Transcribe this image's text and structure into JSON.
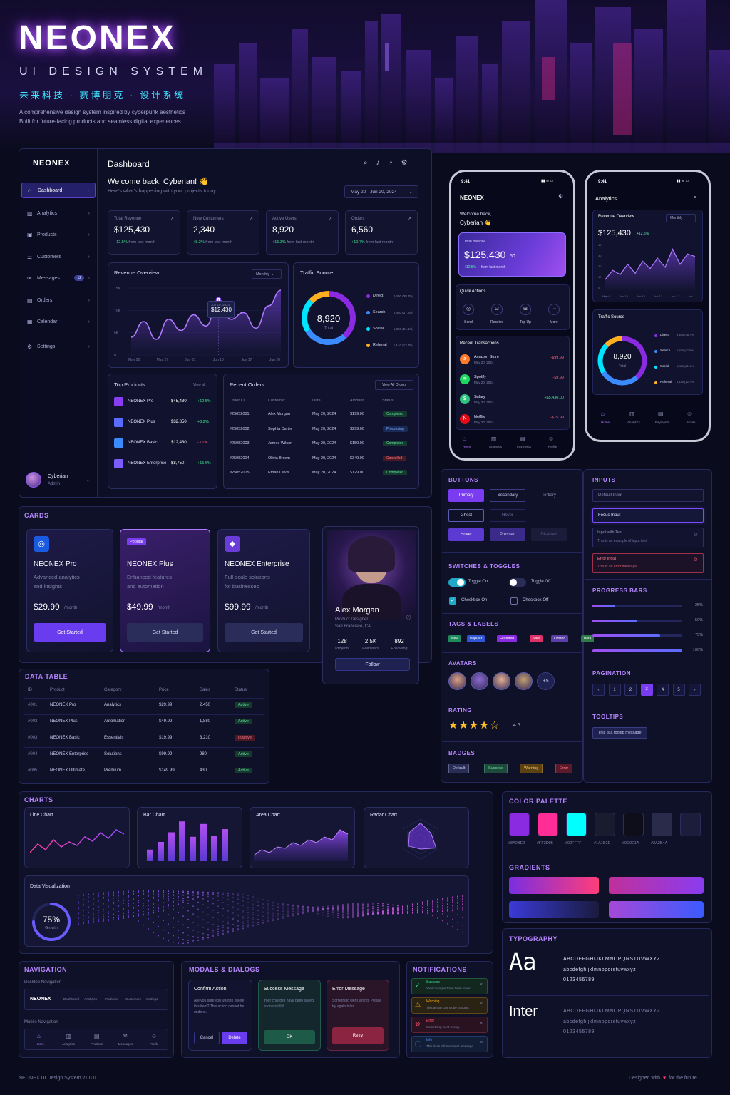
{
  "brand": {
    "name": "NEONEX",
    "subtitle": "UI DESIGN SYSTEM",
    "cn": "未来科技 · 赛博朋克 · 设计系统",
    "desc1": "A comprehensive design system inspired by cyberpunk aesthetics",
    "desc2": "Built for future-facing products and seamless digital experiences."
  },
  "colors": {
    "purple": "#8A2BE2",
    "pink": "#FF2D95",
    "cyan": "#00FFFF",
    "navy": "#1A1B2E",
    "dark": "#0D0E1A",
    "slate": "#2A2B4A"
  },
  "sidebar": {
    "logo": "NEONEX",
    "items": [
      {
        "label": "Dashboard",
        "icon": "home-icon"
      },
      {
        "label": "Analytics",
        "icon": "bar-chart-icon"
      },
      {
        "label": "Products",
        "icon": "box-icon"
      },
      {
        "label": "Customers",
        "icon": "users-icon"
      },
      {
        "label": "Messages",
        "icon": "message-icon",
        "badge": "12"
      },
      {
        "label": "Orders",
        "icon": "orders-icon"
      },
      {
        "label": "Calendar",
        "icon": "calendar-icon"
      },
      {
        "label": "Settings",
        "icon": "gear-icon"
      }
    ],
    "user": {
      "name": "Cyberian",
      "role": "Admin"
    }
  },
  "dashboard": {
    "title": "Dashboard",
    "welcome": "Welcome back, Cyberian! 👋",
    "sub": "Here's what's happening with your projects today.",
    "date": "May 20 - Jun 20, 2024",
    "kpis": [
      {
        "label": "Total Revenue",
        "value": "$125,430",
        "delta": "+12.5%",
        "note": "from last month"
      },
      {
        "label": "New Customers",
        "value": "2,340",
        "delta": "+8.2%",
        "note": "from last month"
      },
      {
        "label": "Active Users",
        "value": "8,920",
        "delta": "+15.3%",
        "note": "from last month"
      },
      {
        "label": "Orders",
        "value": "6,560",
        "delta": "+10.7%",
        "note": "from last month"
      }
    ],
    "revenue": {
      "title": "Revenue Overview",
      "period": "Monthly",
      "tooltip_date": "Jun 10, 2024",
      "tooltip_value": "$12,430",
      "yticks": [
        "15K",
        "10K",
        "5K",
        "0"
      ],
      "xticks": [
        "May 20",
        "May 27",
        "Jun 03",
        "Jun 10",
        "Jun 17",
        "Jun 20"
      ]
    },
    "traffic": {
      "title": "Traffic Source",
      "total": "8,920",
      "total_label": "Total",
      "items": [
        {
          "name": "Direct",
          "value": "3,450 (38.7%)",
          "color": "#8A2BE2"
        },
        {
          "name": "Search",
          "value": "2,450 (27.5%)",
          "color": "#3b8bff"
        },
        {
          "name": "Social",
          "value": "1,880 (21.1%)",
          "color": "#00e5ff"
        },
        {
          "name": "Referral",
          "value": "1,140 (12.7%)",
          "color": "#ffb020"
        }
      ]
    },
    "top_products": {
      "title": "Top Products",
      "link": "View all",
      "items": [
        {
          "name": "NEONEX Pro",
          "value": "$45,430",
          "delta": "+12.5%"
        },
        {
          "name": "NEONEX Plus",
          "value": "$32,850",
          "delta": "+8.2%"
        },
        {
          "name": "NEONEX Basic",
          "value": "$12,430",
          "delta": "-3.1%"
        },
        {
          "name": "NEONEX Enterprise",
          "value": "$8,750",
          "delta": "+15.6%"
        }
      ]
    },
    "orders": {
      "title": "Recent Orders",
      "link": "View All Orders",
      "headers": [
        "Order ID",
        "Customer",
        "Date",
        "Amount",
        "Status"
      ],
      "rows": [
        [
          "#25052001",
          "Alex Morgan",
          "May 20, 2024",
          "$199.00",
          "Completed"
        ],
        [
          "#25052002",
          "Sophia Carter",
          "May 20, 2024",
          "$299.00",
          "Processing"
        ],
        [
          "#25052003",
          "James Wilson",
          "May 20, 2024",
          "$159.00",
          "Completed"
        ],
        [
          "#25052004",
          "Olivia Brown",
          "May 20, 2024",
          "$349.00",
          "Cancelled"
        ],
        [
          "#25052005",
          "Ethan Davis",
          "May 20, 2024",
          "$129.00",
          "Completed"
        ]
      ]
    }
  },
  "phone1": {
    "time": "9:41",
    "logo": "NEONEX",
    "welcome": "Welcome back,",
    "name": "Cyberian 👋",
    "balance_label": "Total Balance",
    "balance": "$125,430",
    "cents": ".50",
    "delta": "+12.5%",
    "delta_note": "from last month",
    "qa_title": "Quick Actions",
    "actions": [
      "Send",
      "Receive",
      "Top Up",
      "More"
    ],
    "tx_title": "Recent Transactions",
    "tx": [
      {
        "name": "Amazon Store",
        "date": "May 20, 2024",
        "amt": "-$99.99"
      },
      {
        "name": "Spotify",
        "date": "May 20, 2024",
        "amt": "-$9.99"
      },
      {
        "name": "Salary",
        "date": "May 20, 2024",
        "amt": "+$5,430.00"
      },
      {
        "name": "Netflix",
        "date": "May 20, 2024",
        "amt": "-$15.99"
      }
    ],
    "nav": [
      "Home",
      "Analytics",
      "Payments",
      "Profile"
    ]
  },
  "phone2": {
    "time": "9:41",
    "title": "Analytics",
    "rev_title": "Revenue Overview",
    "period": "Monthly",
    "value": "$125,430",
    "delta": "+12.5%",
    "yticks": [
      "40",
      "30",
      "20",
      "10",
      "0"
    ],
    "xticks": [
      "May 6",
      "Jun 13",
      "Jun 13",
      "Jun 13",
      "Jun 13",
      "Jun 1"
    ],
    "traffic_title": "Traffic Source",
    "total": "8,920",
    "total_label": "Total",
    "items": [
      {
        "name": "Direct",
        "value": "3,450 (38.7%)"
      },
      {
        "name": "Search",
        "value": "2,450 (27.5%)"
      },
      {
        "name": "Social",
        "value": "1,880 (21.1%)"
      },
      {
        "name": "Referral",
        "value": "1,140 (12.7%)"
      }
    ],
    "nav": [
      "Home",
      "Analytics",
      "Payments",
      "Profile"
    ]
  },
  "buttons": {
    "title": "BUTTONS",
    "row1": [
      "Primary",
      "Secondary",
      "Tertiary"
    ],
    "row2": [
      "Ghost",
      "Hover"
    ],
    "row3": [
      "Hover",
      "Pressed",
      "Disabled"
    ]
  },
  "inputs": {
    "title": "INPUTS",
    "default": "Default Input",
    "focus": "Focus Input",
    "with_text": "Input with Text",
    "with_text_val": "This is an example of input text",
    "error": "Error Input",
    "error_msg": "This is an error message"
  },
  "switches": {
    "title": "SWITCHES & TOGGLES",
    "on": "Toggle On",
    "off": "Toggle Off",
    "cb_on": "Checkbox On",
    "cb_off": "Checkbox Off"
  },
  "progress": {
    "title": "PROGRESS BARS",
    "items": [
      {
        "label": "25%",
        "value": 0.25
      },
      {
        "label": "50%",
        "value": 0.5
      },
      {
        "label": "75%",
        "value": 0.75
      },
      {
        "label": "100%",
        "value": 1
      }
    ]
  },
  "tags": {
    "title": "TAGS & LABELS",
    "items": [
      {
        "label": "New",
        "color": "#1f8a5c"
      },
      {
        "label": "Popular",
        "color": "#3056d3"
      },
      {
        "label": "Featured",
        "color": "#8a2be2"
      },
      {
        "label": "Sale",
        "color": "#e0306a"
      },
      {
        "label": "Limited",
        "color": "#5b3fa8"
      },
      {
        "label": "Beta",
        "color": "#2d7a4a"
      }
    ]
  },
  "pagination": {
    "title": "PAGINATION",
    "pages": [
      "‹",
      "1",
      "2",
      "3",
      "4",
      "5",
      "›"
    ],
    "active": "3"
  },
  "avatars": {
    "title": "AVATARS",
    "more": "+5"
  },
  "tooltips": {
    "title": "TOOLTIPS",
    "text": "This is a tooltip message"
  },
  "rating": {
    "title": "RATING",
    "value": "4.5",
    "stars": 4.5
  },
  "badges": {
    "title": "BADGES",
    "items": [
      {
        "label": "Default",
        "bg": "#2a2d55",
        "fg": "#c8cbee"
      },
      {
        "label": "Success",
        "bg": "#1d4a3a",
        "fg": "#6ee0a8"
      },
      {
        "label": "Warning",
        "bg": "#5a4214",
        "fg": "#ffc25a"
      },
      {
        "label": "Error",
        "bg": "#5a1a2a",
        "fg": "#ff7a8f"
      }
    ]
  },
  "cards": {
    "title": "CARDS",
    "plans": [
      {
        "name": "NEONEX Pro",
        "desc1": "Advanced analytics",
        "desc2": "and insights",
        "price": "$29.99",
        "per": "/month",
        "cta": "Get Started"
      },
      {
        "tag": "Popular",
        "name": "NEONEX Plus",
        "desc1": "Enhanced features",
        "desc2": "and automation",
        "price": "$49.99",
        "per": "/month",
        "cta": "Get Started"
      },
      {
        "name": "NEONEX Enterprise",
        "desc1": "Full-scale solutions",
        "desc2": "for businesses",
        "price": "$99.99",
        "per": "/month",
        "cta": "Get Started"
      }
    ],
    "profile": {
      "name": "Alex Morgan",
      "role": "Product Designer",
      "location": "San Francisco, CA",
      "stats": [
        {
          "v": "128",
          "l": "Projects"
        },
        {
          "v": "2.5K",
          "l": "Followers"
        },
        {
          "v": "892",
          "l": "Following"
        }
      ],
      "cta": "Follow"
    }
  },
  "table": {
    "title": "DATA TABLE",
    "headers": [
      "ID",
      "Product",
      "Category",
      "Price",
      "Sales",
      "Status"
    ],
    "rows": [
      [
        "#001",
        "NEONEX Pro",
        "Analytics",
        "$29.99",
        "2,450",
        "Active"
      ],
      [
        "#002",
        "NEONEX Plus",
        "Automation",
        "$49.99",
        "1,880",
        "Active"
      ],
      [
        "#003",
        "NEONEX Basic",
        "Essentials",
        "$19.99",
        "3,210",
        "Inactive"
      ],
      [
        "#004",
        "NEONEX Enterprise",
        "Solutions",
        "$99.99",
        "980",
        "Active"
      ],
      [
        "#005",
        "NEONEX Ultimate",
        "Premium",
        "$149.99",
        "430",
        "Active"
      ]
    ]
  },
  "charts": {
    "title": "CHARTS",
    "line": "Line Chart",
    "bar": "Bar Chart",
    "area": "Area Chart",
    "radar": "Radar Chart",
    "viz": "Data Visualization",
    "gauge_value": "75%",
    "gauge_label": "Growth",
    "gauge": 0.75
  },
  "chart_data": [
    {
      "type": "line",
      "title": "Revenue Overview",
      "categories": [
        "May 20",
        "May 27",
        "Jun 03",
        "Jun 10",
        "Jun 17",
        "Jun 20"
      ],
      "ylim": [
        0,
        15000
      ],
      "values": [
        4000,
        7500,
        3500,
        8000,
        5500,
        9000,
        6500,
        12430,
        8000,
        9500,
        6000,
        11000,
        14500
      ]
    },
    {
      "type": "bar",
      "title": "Bar Chart",
      "values": [
        18,
        30,
        45,
        62,
        38,
        58,
        40,
        50
      ]
    },
    {
      "type": "pie",
      "title": "Traffic Source",
      "categories": [
        "Direct",
        "Search",
        "Social",
        "Referral"
      ],
      "values": [
        3450,
        2450,
        1880,
        1140
      ]
    }
  ],
  "palette": {
    "title": "COLOR PALETTE",
    "colors": [
      "#8A2BE2",
      "#FF2D95",
      "#00FFFF",
      "#1A1B2E",
      "#0D0E1A",
      "#2A2B4A",
      "#1c1d3a"
    ],
    "labels": [
      "#8A2BE2",
      "#FF2D95",
      "#00FFFF",
      "#1A1B2E",
      "#0D0E1A",
      "#2A2B4A"
    ]
  },
  "gradients": {
    "title": "GRADIENTS"
  },
  "typography": {
    "title": "TYPOGRAPHY",
    "sample": "Aa",
    "upper": "ABCDEFGHIJKLMNOPQRSTUVWXYZ",
    "lower": "abcdefghijklmnopqrstuvwxyz",
    "digits": "0123456789",
    "font2": "Inter"
  },
  "navigation": {
    "title": "NAVIGATION",
    "desktop": "Desktop Navigation",
    "logo": "NEONEX",
    "links": [
      "Dashboard",
      "Analytics",
      "Products",
      "Customers",
      "Settings"
    ],
    "mobile": "Mobile Navigation",
    "mobile_items": [
      "Home",
      "Analytics",
      "Products",
      "Messages",
      "Profile"
    ]
  },
  "modals": {
    "title": "MODALS & DIALOGS",
    "confirm": {
      "title": "Confirm Action",
      "body": "Are you sure you want to delete this item? This action cannot be undone.",
      "cancel": "Cancel",
      "ok": "Delete"
    },
    "success": {
      "title": "Success Message",
      "body": "Your changes have been saved successfully!",
      "ok": "OK"
    },
    "error": {
      "title": "Error Message",
      "body": "Something went wrong. Please try again later.",
      "ok": "Retry"
    }
  },
  "notifications": {
    "title": "NOTIFICATIONS",
    "items": [
      {
        "t": "Success",
        "m": "Your changes have been saved.",
        "c": "#3ee08f"
      },
      {
        "t": "Warning",
        "m": "This action cannot be undone.",
        "c": "#ffb020"
      },
      {
        "t": "Error",
        "m": "Something went wrong.",
        "c": "#ff4f6a"
      },
      {
        "t": "Info",
        "m": "This is an informational message.",
        "c": "#4f8cff"
      }
    ]
  },
  "footer": {
    "left": "NEONEX UI Design System v1.0.0",
    "right_a": "Designed with",
    "right_b": "for the future"
  }
}
